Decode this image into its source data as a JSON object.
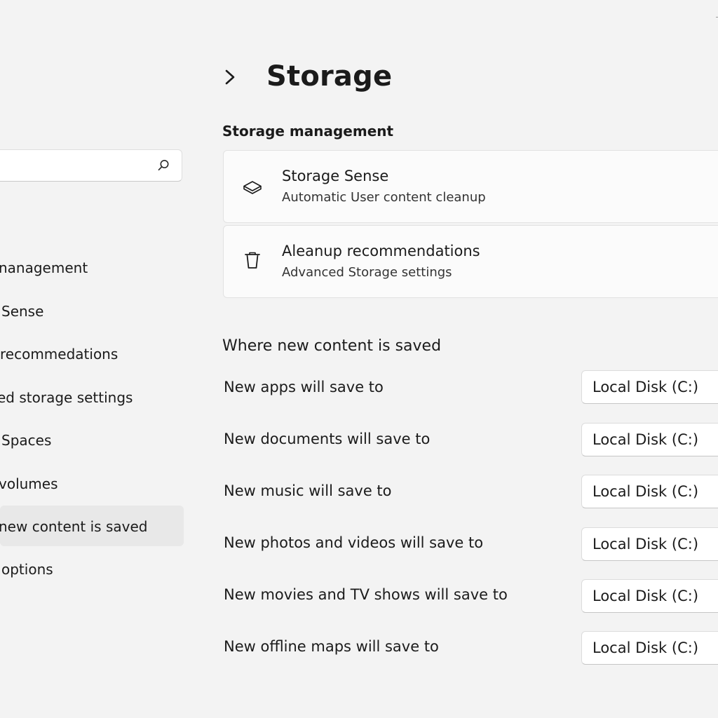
{
  "header": {
    "title": "Storage"
  },
  "sidebar": {
    "search": {
      "value": "",
      "placeholder": ""
    },
    "items": [
      {
        "label": "nanagement"
      },
      {
        "label": "Sense"
      },
      {
        "label": "recommedations"
      },
      {
        "label": "ed storage settings"
      },
      {
        "label": "Spaces"
      },
      {
        "label": "volumes"
      },
      {
        "label": "new content is saved",
        "selected": true
      },
      {
        "label": "options"
      }
    ]
  },
  "storage_management": {
    "heading": "Storage management",
    "cards": [
      {
        "title": "Storage Sense",
        "subtitle": "Automatic User content cleanup",
        "icon": "storage-sense-icon"
      },
      {
        "title": "Aleanup recommendations",
        "subtitle": "Advanced Storage settings",
        "icon": "trash-icon"
      }
    ]
  },
  "save_locations": {
    "heading": "Where new content is saved",
    "rows": [
      {
        "label": "New apps will save to",
        "value": "Local Disk (C:)"
      },
      {
        "label": "New documents will save to",
        "value": "Local Disk (C:)"
      },
      {
        "label": "New music will save to",
        "value": "Local Disk (C:)"
      },
      {
        "label": "New photos and videos will save to",
        "value": "Local Disk (C:)"
      },
      {
        "label": "New movies and TV shows will save to",
        "value": "Local Disk (C:)"
      },
      {
        "label": "New offline maps will save to",
        "value": "Local Disk (C:)"
      }
    ]
  },
  "colors": {
    "background": "#f3f3f3",
    "card": "#fbfbfb",
    "selected_nav": "#e8e8e8",
    "text": "#1b1b1b"
  }
}
